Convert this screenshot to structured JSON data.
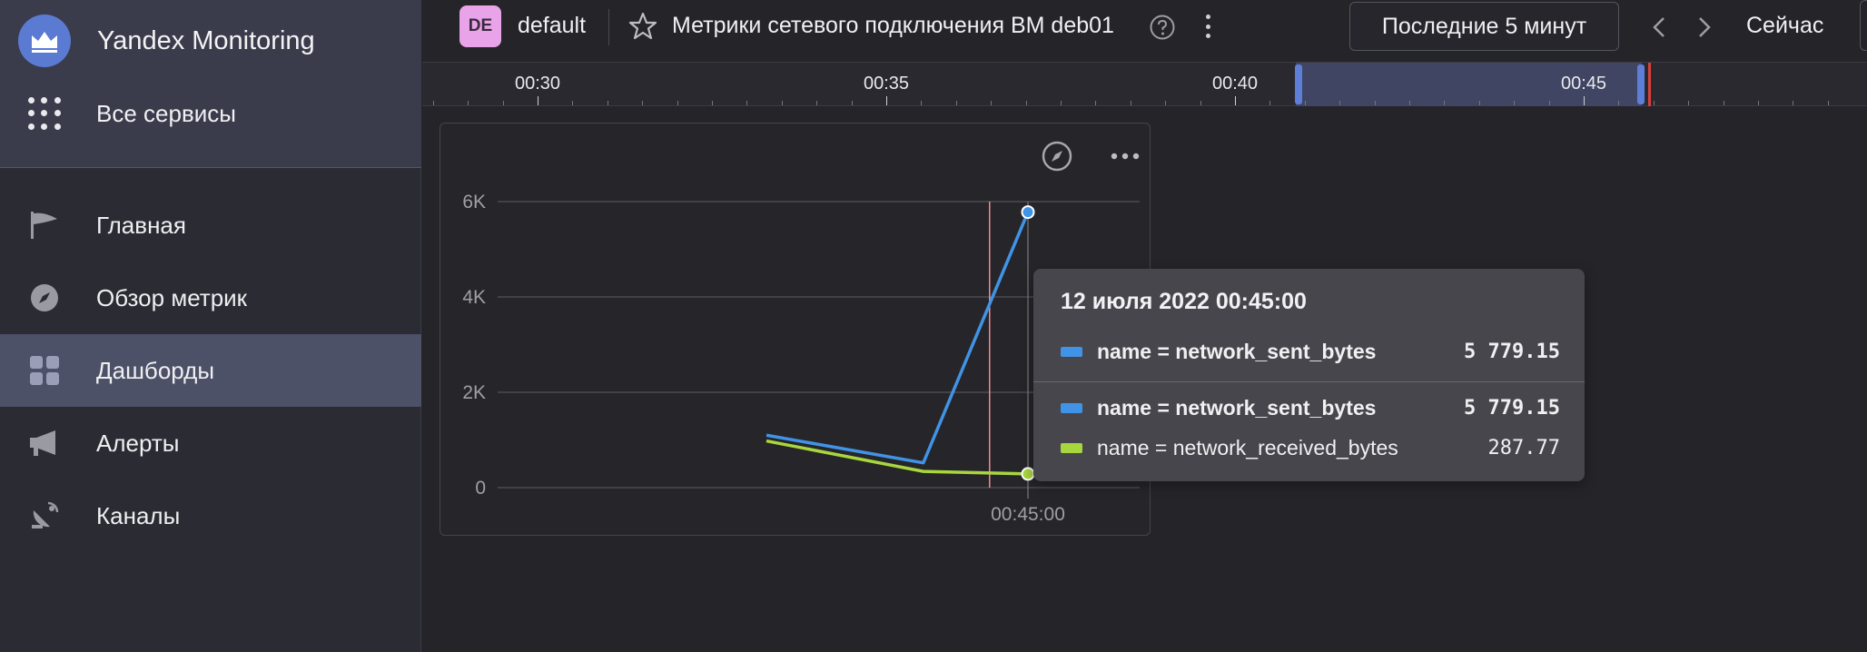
{
  "sidebar": {
    "brand": "Yandex Monitoring",
    "all_services": "Все сервисы",
    "items": [
      {
        "label": "Главная",
        "icon": "flag-icon"
      },
      {
        "label": "Обзор метрик",
        "icon": "compass-icon"
      },
      {
        "label": "Дашборды",
        "icon": "dashboard-grid-icon",
        "active": true
      },
      {
        "label": "Алерты",
        "icon": "megaphone-icon"
      },
      {
        "label": "Каналы",
        "icon": "satellite-dish-icon"
      }
    ]
  },
  "header": {
    "workspace_badge": "DE",
    "workspace_name": "default",
    "dashboard_title": "Метрики сетевого подключения ВМ deb01",
    "time_range": "Последние 5 минут",
    "now_label": "Сейчас"
  },
  "timeline": {
    "labels": [
      "00:30",
      "00:35",
      "00:40",
      "00:45"
    ]
  },
  "colors": {
    "accent": "#5b7bd3",
    "series_sent": "#4193e6",
    "series_received": "#a8d63e",
    "cursor_line": "#ee8e96",
    "now_marker": "#d8403a"
  },
  "chart_data": {
    "type": "line",
    "y_ticks": [
      "6K",
      "4K",
      "2K",
      "0"
    ],
    "x_tick_label": "00:45:00",
    "ylim": [
      0,
      6000
    ],
    "series": [
      {
        "name": "network_sent_bytes",
        "color": "#4193e6",
        "points": [
          [
            -75,
            1100
          ],
          [
            -30,
            520
          ],
          [
            0,
            5779.15
          ]
        ]
      },
      {
        "name": "network_received_bytes",
        "color": "#a8d63e",
        "points": [
          [
            -75,
            980
          ],
          [
            -30,
            340
          ],
          [
            0,
            287.77
          ]
        ]
      }
    ]
  },
  "tooltip": {
    "date": "12 июля 2022 00:45:00",
    "rows": [
      {
        "label": "name = network_sent_bytes",
        "value": "5 779.15"
      },
      {
        "label": "name = network_sent_bytes",
        "value": "5 779.15"
      },
      {
        "label": "name = network_received_bytes",
        "value": "287.77"
      }
    ]
  }
}
